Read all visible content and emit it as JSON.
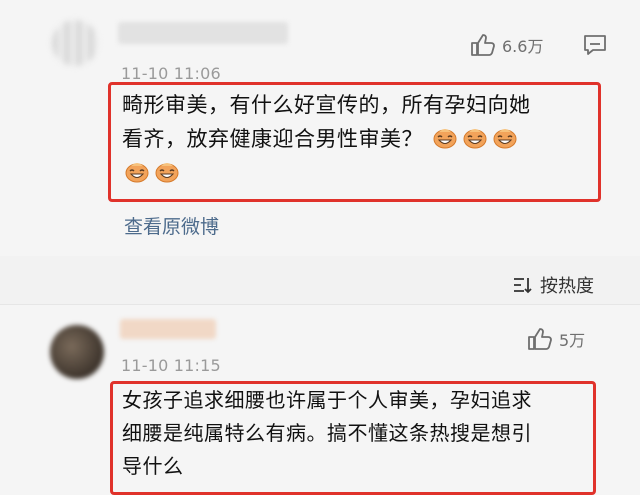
{
  "comments": [
    {
      "timestamp": "11-10 11:06",
      "likes": "6.6万",
      "text_line1": "畸形审美，有什么好宣传的，所有孕妇向她",
      "text_line2": "看齐，放弃健康迎合男性审美？",
      "emoji_name": "laughing-emoji",
      "emoji_count": 5,
      "view_original": "查看原微博"
    },
    {
      "timestamp": "11-10 11:15",
      "likes": "5万",
      "text_line1": "女孩子追求细腰也许属于个人审美，孕妇追求",
      "text_line2": "细腰是纯属特么有病。搞不懂这条热搜是想引",
      "text_line3": "导什么"
    }
  ],
  "sort": {
    "label": "按热度",
    "icon": "sort-icon"
  },
  "icons": {
    "like": "thumbs-up-icon",
    "reply": "comment-icon"
  },
  "colors": {
    "highlight_border": "#e0322b",
    "link": "#4d6b8c",
    "meta": "#9a9a9a"
  }
}
